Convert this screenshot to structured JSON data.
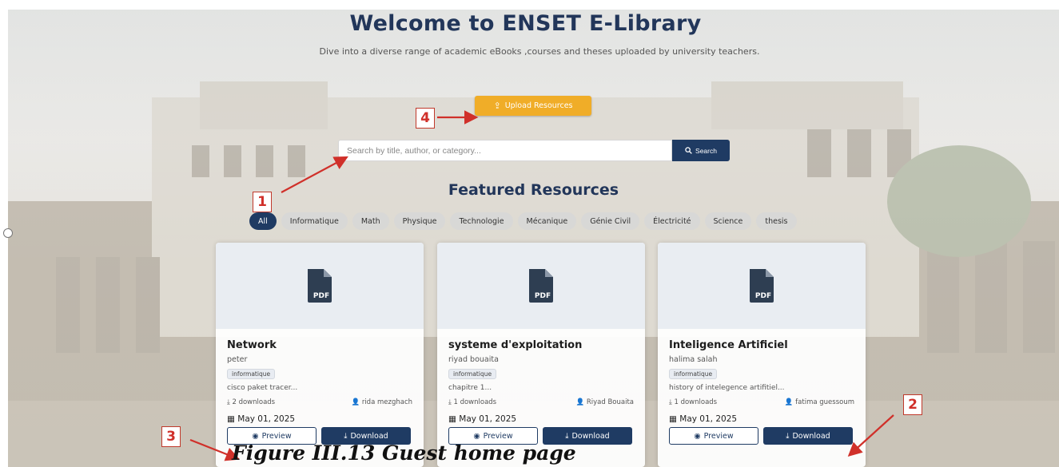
{
  "header": {
    "title": "Welcome to ENSET E-Library",
    "subtitle": "Dive into a diverse range of academic eBooks ,courses and theses uploaded by university teachers."
  },
  "upload": {
    "label": "Upload Resources",
    "icon": "upload-icon"
  },
  "search": {
    "placeholder": "Search by title, author, or category...",
    "button_label": "Search",
    "icon": "search-icon"
  },
  "featured": {
    "title": "Featured Resources"
  },
  "categories": [
    "All",
    "Informatique",
    "Math",
    "Physique",
    "Technologie",
    "Mécanique",
    "Génie Civil",
    "Électricité",
    "Science",
    "thesis"
  ],
  "active_category": "All",
  "cards": [
    {
      "title": "Network",
      "author": "peter",
      "category": "informatique",
      "description": "cisco paket tracer...",
      "downloads": "2 downloads",
      "uploader": "rida mezghach",
      "date": "May 01, 2025",
      "preview_label": "Preview",
      "download_label": "Download"
    },
    {
      "title": "systeme d'exploitation",
      "author": "riyad bouaita",
      "category": "informatique",
      "description": "chapitre 1...",
      "downloads": "1 downloads",
      "uploader": "Riyad Bouaita",
      "date": "May 01, 2025",
      "preview_label": "Preview",
      "download_label": "Download"
    },
    {
      "title": "Inteligence Artificiel",
      "author": "halima salah",
      "category": "informatique",
      "description": "history of intelegence artifitiel...",
      "downloads": "1 downloads",
      "uploader": "fatima guessoum",
      "date": "May 01, 2025",
      "preview_label": "Preview",
      "download_label": "Download"
    }
  ],
  "callouts": [
    "1",
    "2",
    "3",
    "4"
  ],
  "caption": "Figure III.13 Guest home page",
  "colors": {
    "navy": "#1f3b63",
    "title": "#22365a",
    "upload": "#f0ad28",
    "callout": "#d0302a"
  }
}
